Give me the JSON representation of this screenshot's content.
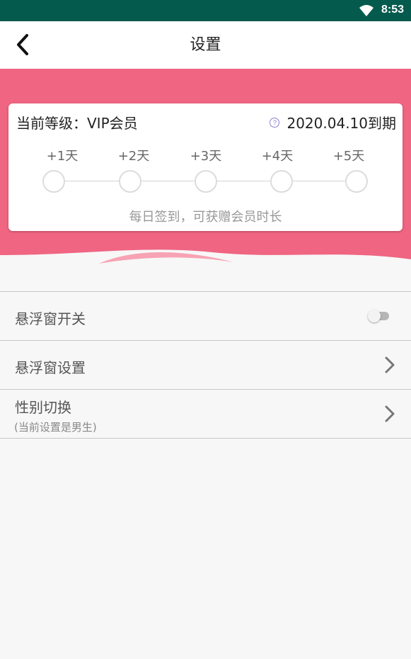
{
  "status_bar": {
    "time": "8:53"
  },
  "header": {
    "title": "设置"
  },
  "vip_card": {
    "level_label": "当前等级：VIP会员",
    "expire_text": "2020.04.10到期",
    "days": [
      "+1天",
      "+2天",
      "+3天",
      "+4天",
      "+5天"
    ],
    "hint": "每日签到，可获赠会员时长"
  },
  "settings": {
    "float_window_toggle": {
      "label": "悬浮窗开关",
      "enabled": false
    },
    "float_window_settings": {
      "label": "悬浮窗设置"
    },
    "gender_switch": {
      "label": "性别切换",
      "subtitle": "(当前设置是男生)"
    }
  },
  "colors": {
    "status_bar": "#045a4d",
    "banner": "#ef6582",
    "background": "#f7f7f7"
  }
}
